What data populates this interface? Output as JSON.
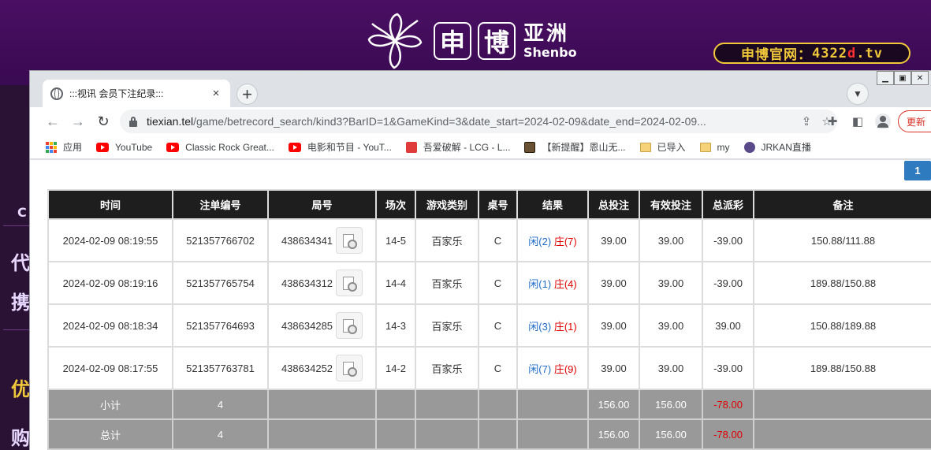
{
  "site": {
    "brand_char1": "申",
    "brand_char2": "博",
    "brand_cn": "亚洲",
    "brand_en": "Shenbo",
    "url_label": "申博官网：",
    "url_main": "4322",
    "url_red": "d",
    "url_tail": ".tv",
    "left_chars": [
      "C",
      "代",
      "携",
      "优",
      "购"
    ]
  },
  "browser": {
    "tab_title": ":::视讯 会员下注纪录:::",
    "tab_close": "×",
    "new_tab": "+",
    "url_host": "tiexian.tel",
    "url_path": "/game/betrecord_search/kind3?BarID=1&GameKind=3&date_start=2024-02-09&date_end=2024-02-09...",
    "update_label": "更新",
    "bookmarks": [
      {
        "icon": "apps-icon",
        "label": "应用"
      },
      {
        "icon": "youtube-icon",
        "label": "YouTube"
      },
      {
        "icon": "youtube-icon",
        "label": "Classic Rock Great..."
      },
      {
        "icon": "youtube-icon",
        "label": "电影和节目 - YouT..."
      },
      {
        "icon": "lcg-icon",
        "label": "吾爱破解 - LCG - L..."
      },
      {
        "icon": "image-icon",
        "label": "【新提醒】恩山无..."
      },
      {
        "icon": "folder-icon",
        "label": "已导入"
      },
      {
        "icon": "folder-icon",
        "label": "my"
      },
      {
        "icon": "jrkan-icon",
        "label": "JRKAN直播"
      }
    ]
  },
  "page": {
    "page_number": "1",
    "headers": [
      "时间",
      "注单编号",
      "局号",
      "场次",
      "游戏类别",
      "桌号",
      "结果",
      "总投注",
      "有效投注",
      "总派彩",
      "备注"
    ],
    "rows": [
      {
        "time": "2024-02-09 08:19:55",
        "bet_id": "521357766702",
        "round": "438634341",
        "session": "14-5",
        "game": "百家乐",
        "table": "C",
        "res_x": "闲(2)",
        "res_z": "庄(7)",
        "total": "39.00",
        "valid": "39.00",
        "payout": "-39.00",
        "payout_neg": true,
        "note": "150.88/111.88"
      },
      {
        "time": "2024-02-09 08:19:16",
        "bet_id": "521357765754",
        "round": "438634312",
        "session": "14-4",
        "game": "百家乐",
        "table": "C",
        "res_x": "闲(1)",
        "res_z": "庄(4)",
        "total": "39.00",
        "valid": "39.00",
        "payout": "-39.00",
        "payout_neg": true,
        "note": "189.88/150.88"
      },
      {
        "time": "2024-02-09 08:18:34",
        "bet_id": "521357764693",
        "round": "438634285",
        "session": "14-3",
        "game": "百家乐",
        "table": "C",
        "res_x": "闲(3)",
        "res_z": "庄(1)",
        "total": "39.00",
        "valid": "39.00",
        "payout": "39.00",
        "payout_neg": false,
        "note": "150.88/189.88"
      },
      {
        "time": "2024-02-09 08:17:55",
        "bet_id": "521357763781",
        "round": "438634252",
        "session": "14-2",
        "game": "百家乐",
        "table": "C",
        "res_x": "闲(7)",
        "res_z": "庄(9)",
        "total": "39.00",
        "valid": "39.00",
        "payout": "-39.00",
        "payout_neg": true,
        "note": "189.88/150.88"
      }
    ],
    "subtotal": {
      "label": "小计",
      "count": "4",
      "total": "156.00",
      "valid": "156.00",
      "payout": "-78.00"
    },
    "grandtotal": {
      "label": "总计",
      "count": "4",
      "total": "156.00",
      "valid": "156.00",
      "payout": "-78.00"
    }
  },
  "colors": {
    "header_bg": "#1e1e1e",
    "summary_bg": "#999999",
    "negative": "#e00000",
    "blue_amount": "#1f6bc7",
    "page_button": "#2f7bbf"
  }
}
